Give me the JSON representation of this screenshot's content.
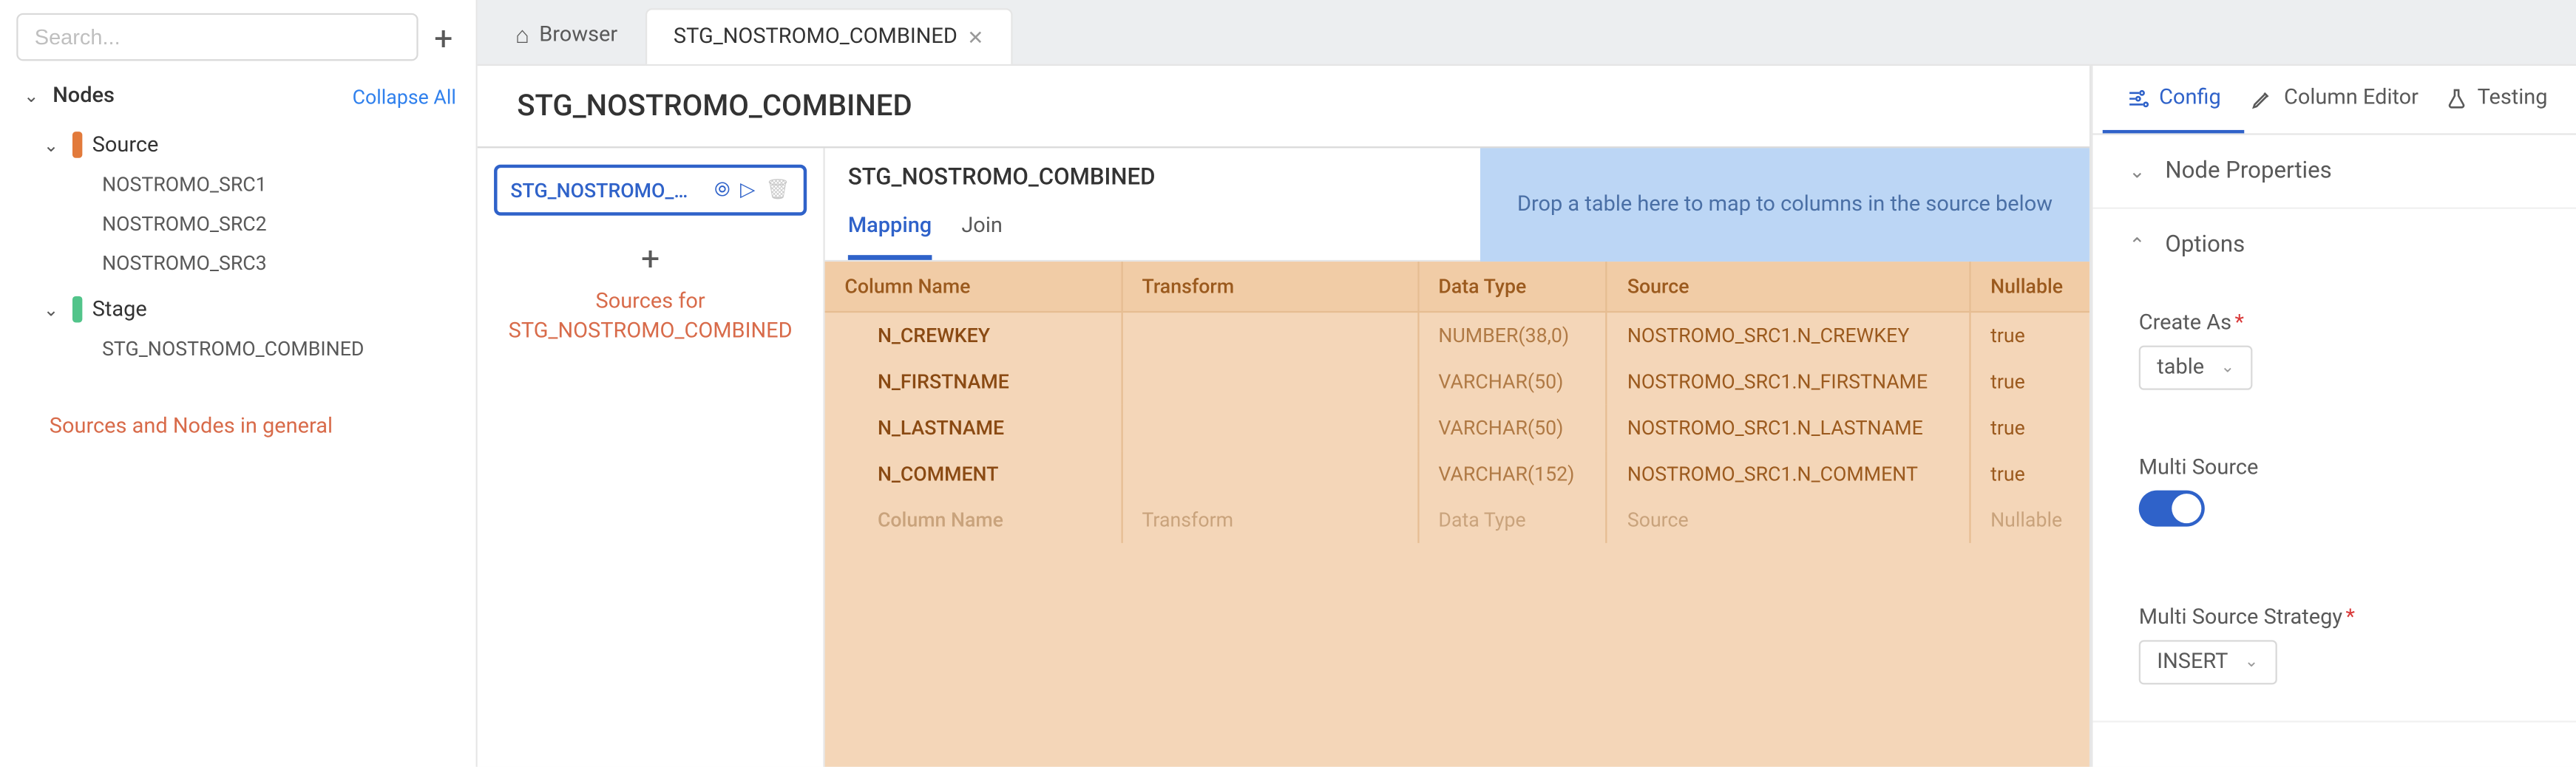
{
  "sidebar": {
    "search_placeholder": "Search...",
    "nodes_label": "Nodes",
    "collapse_all": "Collapse All",
    "groups": [
      {
        "label": "Source",
        "kind": "source",
        "items": [
          "NOSTROMO_SRC1",
          "NOSTROMO_SRC2",
          "NOSTROMO_SRC3"
        ]
      },
      {
        "label": "Stage",
        "kind": "stage",
        "items": [
          "STG_NOSTROMO_COMBINED"
        ]
      }
    ],
    "annotation": "Sources and Nodes in general"
  },
  "tabs": {
    "browser_label": "Browser",
    "active_label": "STG_NOSTROMO_COMBINED"
  },
  "page": {
    "title": "STG_NOSTROMO_COMBINED"
  },
  "sources": {
    "active_card": "STG_NOSTROMO_CO...",
    "annotation_line1": "Sources for",
    "annotation_line2": "STG_NOSTROMO_COMBINED"
  },
  "mapping": {
    "title": "STG_NOSTROMO_COMBINED",
    "subtabs": {
      "mapping": "Mapping",
      "join": "Join"
    },
    "dropzone": "Drop a table here to map to columns in the source below",
    "headers": {
      "column_name": "Column Name",
      "transform": "Transform",
      "data_type": "Data Type",
      "source": "Source",
      "nullable": "Nullable"
    },
    "rows": [
      {
        "name": "N_CREWKEY",
        "transform": "",
        "data_type": "NUMBER(38,0)",
        "source": "NOSTROMO_SRC1.N_CREWKEY",
        "nullable": "true"
      },
      {
        "name": "N_FIRSTNAME",
        "transform": "",
        "data_type": "VARCHAR(50)",
        "source": "NOSTROMO_SRC1.N_FIRSTNAME",
        "nullable": "true"
      },
      {
        "name": "N_LASTNAME",
        "transform": "",
        "data_type": "VARCHAR(50)",
        "source": "NOSTROMO_SRC1.N_LASTNAME",
        "nullable": "true"
      },
      {
        "name": "N_COMMENT",
        "transform": "",
        "data_type": "VARCHAR(152)",
        "source": "NOSTROMO_SRC1.N_COMMENT",
        "nullable": "true"
      }
    ],
    "placeholder": {
      "column_name": "Column Name",
      "transform": "Transform",
      "data_type": "Data Type",
      "source": "Source",
      "nullable": "Nullable"
    }
  },
  "props": {
    "tabs": {
      "config": "Config",
      "column_editor": "Column Editor",
      "testing": "Testing"
    },
    "node_properties": "Node Properties",
    "options": "Options",
    "create_as_label": "Create As",
    "create_as_value": "table",
    "multi_source_label": "Multi Source",
    "multi_source_strategy_label": "Multi Source Strategy",
    "multi_source_strategy_value": "INSERT"
  }
}
